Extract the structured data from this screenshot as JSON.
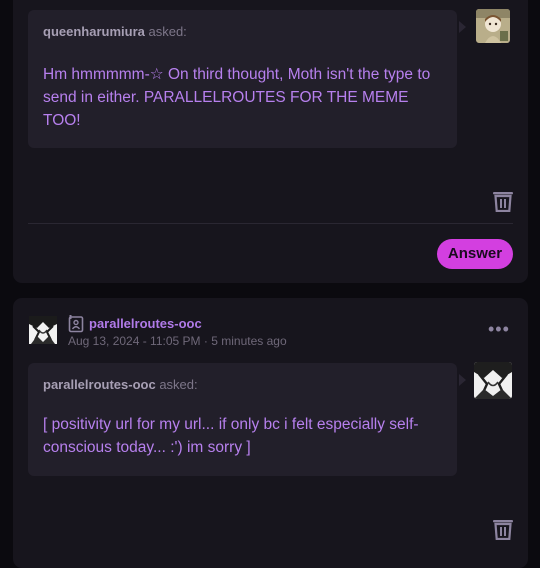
{
  "posts": [
    {
      "asker_name": "queenharumiura",
      "asked_suffix": "asked:",
      "question": "Hm hmmmmm-☆ On third thought, Moth isn't the type to send in either. PARALLELROUTES FOR THE MEME TOO!",
      "answer_label": "Answer"
    },
    {
      "blog_name": "parallelroutes-ooc",
      "date": "Aug 13, 2024 - 11:05 PM",
      "separator": "·",
      "relative_time": "5 minutes ago",
      "more_label": "•••",
      "asker_name": "parallelroutes-ooc",
      "asked_suffix": "asked:",
      "question": "[ positivity url for my url... if only bc i felt especially self-conscious today... :') im sorry ]"
    }
  ],
  "colors": {
    "accent": "#d33fe0",
    "question_text": "#b780ee",
    "card_bg": "#17151d",
    "ask_bg": "#221f2a"
  },
  "icons": [
    "trash-icon",
    "blog-icon",
    "more-options-icon"
  ]
}
